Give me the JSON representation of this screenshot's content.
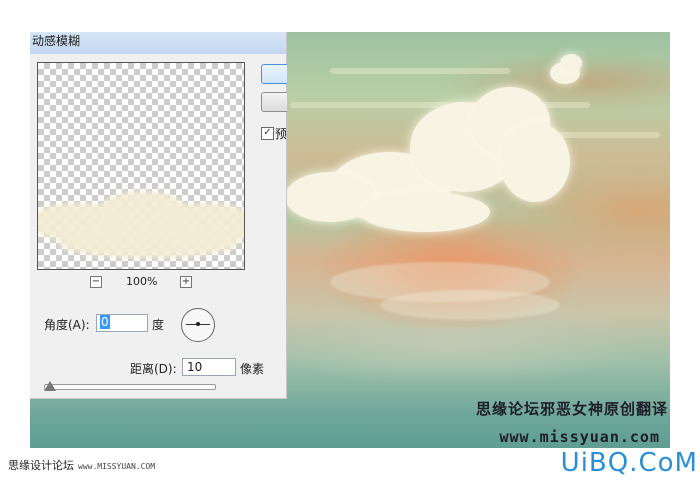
{
  "dialog": {
    "title": "动感模糊",
    "zoom": {
      "minus_label": "−",
      "plus_label": "+",
      "value": "100%"
    },
    "angle": {
      "label": "角度(A):",
      "value": "0",
      "unit": "度"
    },
    "distance": {
      "label": "距离(D):",
      "value": "10",
      "unit": "像素"
    },
    "preview_checkbox": {
      "label": "预",
      "checked": true,
      "mark": "✓"
    }
  },
  "watermark": {
    "chinese": "思缘论坛邪恶女神原创翻译",
    "url": "www.missyuan.com"
  },
  "footer": {
    "left_text": "思缘设计论坛",
    "left_url": "www.MISSYUAN.COM",
    "right_logo": "UiBQ.CoM"
  }
}
